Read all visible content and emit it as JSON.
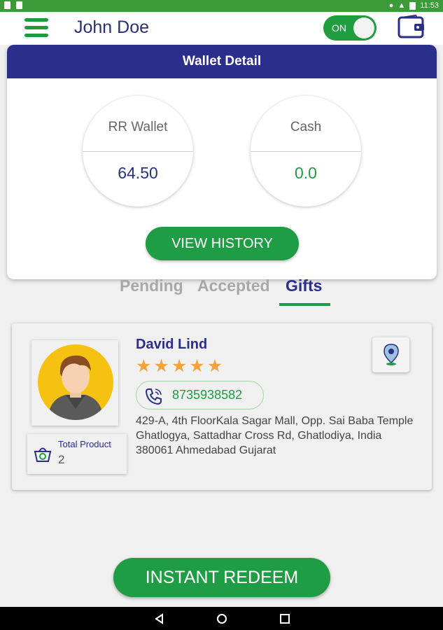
{
  "status_bar": {
    "time": "11:53"
  },
  "header": {
    "title": "John Doe",
    "toggle_label": "ON",
    "wallet_icon": "wallet-icon",
    "menu_icon": "hamburger-menu-icon"
  },
  "wallet": {
    "title": "Wallet Detail",
    "rr_label": "RR Wallet",
    "rr_value": "64.50",
    "cash_label": "Cash",
    "cash_value": "0.0",
    "history_button": "VIEW HISTORY"
  },
  "tabs": [
    {
      "label": "Pending",
      "active": false
    },
    {
      "label": "Accepted",
      "active": false
    },
    {
      "label": "Gifts",
      "active": true
    }
  ],
  "gift": {
    "name": "David Lind",
    "rating": 5,
    "phone": "8735938582",
    "address": "429-A, 4th FloorKala Sagar Mall,  Opp. Sai Baba Temple Ghatlogya,  Sattadhar Cross Rd, Ghatlodiya,  India 380061 Ahmedabad Gujarat",
    "total_product_label": "Total Product",
    "total_product_value": "2"
  },
  "redeem_button": "INSTANT REDEEM",
  "colors": {
    "green": "#1f9d44",
    "navy": "#2a2f8c",
    "star": "#f2a43a"
  }
}
